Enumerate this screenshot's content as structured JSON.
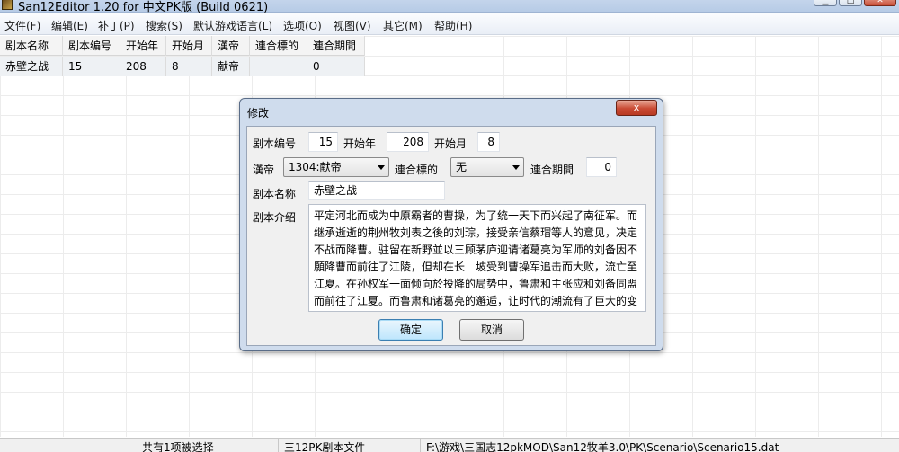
{
  "window": {
    "title": "San12Editor 1.20 for 中文PK版 (Build 0621)"
  },
  "menu": [
    "文件(F)",
    "编辑(E)",
    "补丁(P)",
    "搜索(S)",
    "默认游戏语言(L)",
    "选项(O)",
    "视图(V)",
    "其它(M)",
    "帮助(H)"
  ],
  "table": {
    "columns": [
      "剧本名称",
      "剧本编号",
      "开始年",
      "开始月",
      "漢帝",
      "連合標的",
      "連合期間"
    ],
    "rows": [
      [
        "赤壁之战",
        "15",
        "208",
        "8",
        "献帝",
        "",
        "0"
      ]
    ]
  },
  "dialog": {
    "title": "修改",
    "close_label": "x",
    "labels": {
      "scenario_no": "剧本编号",
      "start_year": "开始年",
      "start_month": "开始月",
      "emperor": "漢帝",
      "alliance_target": "連合標的",
      "alliance_period": "連合期間",
      "scenario_name": "剧本名称",
      "intro": "剧本介绍"
    },
    "values": {
      "scenario_no": "15",
      "start_year": "208",
      "start_month": "8",
      "emperor": "1304:献帝",
      "alliance_target": "无",
      "alliance_period": "0",
      "scenario_name": "赤壁之战",
      "intro": "平定河北而成为中原霸者的曹操，为了统一天下而兴起了南征军。而继承逝逝的荆州牧刘表之後的刘琮，接受亲信蔡瑁等人的意见，决定不战而降曹。驻留在新野並以三顾茅庐迎请诸葛亮为军师的刘备因不願降曹而前往了江陵，但却在长　坡受到曹操军追击而大败，流亡至江夏。在孙权军一面倾向於投降的局势中，鲁肃和主张应和刘备同盟而前往了江夏。而鲁肃和诸葛亮的邂逅，让时代的潮流有了巨大的变"
    },
    "ok_label": "确定",
    "cancel_label": "取消"
  },
  "status": {
    "selection": "共有1项被选择",
    "file_type": "三12PK剧本文件",
    "path": "F:\\游戏\\三国志12pkMOD\\San12牧羊3.0\\PK\\Scenario\\Scenario15.dat"
  }
}
